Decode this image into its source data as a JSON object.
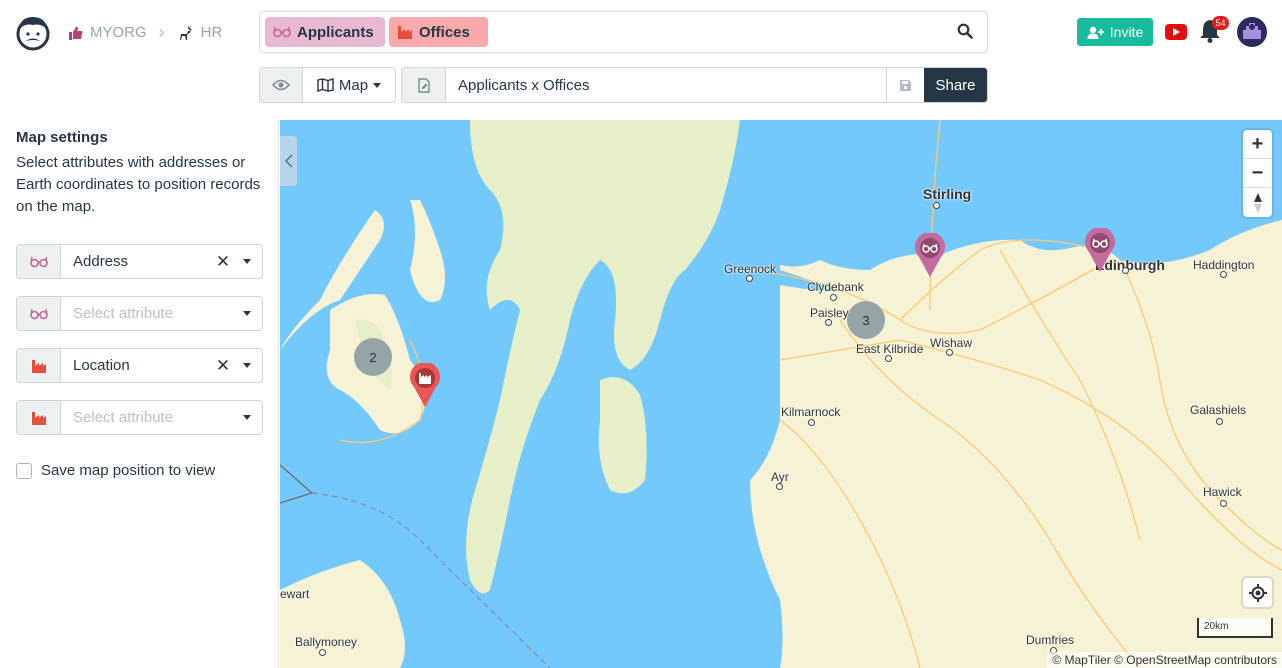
{
  "header": {
    "org": "MYORG",
    "workspace": "HR",
    "tables": [
      {
        "name": "Applicants",
        "color": "#e8b9d0",
        "icon": "glasses-icon"
      },
      {
        "name": "Offices",
        "color": "#f8a9ab",
        "icon": "industry-icon"
      }
    ],
    "view_type": "Map",
    "view_name": "Applicants x Offices",
    "share_label": "Share",
    "invite_label": "Invite",
    "notification_count": "54"
  },
  "sidebar": {
    "title": "Map settings",
    "description": "Select attributes with addresses or Earth coordinates to position records on the map.",
    "attributes": [
      {
        "table": "Applicants",
        "icon": "glasses-icon",
        "value": "Address",
        "placeholder": "Select attribute"
      },
      {
        "table": "Applicants",
        "icon": "glasses-icon",
        "value": "",
        "placeholder": "Select attribute"
      },
      {
        "table": "Offices",
        "icon": "industry-icon",
        "value": "Location",
        "placeholder": "Select attribute"
      },
      {
        "table": "Offices",
        "icon": "industry-icon",
        "value": "",
        "placeholder": "Select attribute"
      }
    ],
    "save_position_label": "Save map position to view",
    "save_position_checked": false
  },
  "map": {
    "places": [
      "Stirling",
      "Edinburgh",
      "Haddington",
      "Greenock",
      "Clydebank",
      "Paisley",
      "East Kilbride",
      "Wishaw",
      "Kilmarnock",
      "Galashiels",
      "Ayr",
      "Hawick",
      "Dumfries",
      "Ballymoney",
      "ewart"
    ],
    "clusters": [
      {
        "count": "2"
      },
      {
        "count": "3"
      }
    ],
    "markers": [
      {
        "table": "Offices",
        "color": "#e74c3c"
      },
      {
        "table": "Applicants",
        "color": "#c8649a"
      },
      {
        "table": "Applicants",
        "color": "#c8649a"
      }
    ],
    "scale_label": "20km",
    "attribution": "© MapTiler © OpenStreetMap contributors"
  },
  "colors": {
    "applicants": "#c8649a",
    "offices": "#e74c3c",
    "primary": "#253746",
    "success": "#18bc9c"
  }
}
